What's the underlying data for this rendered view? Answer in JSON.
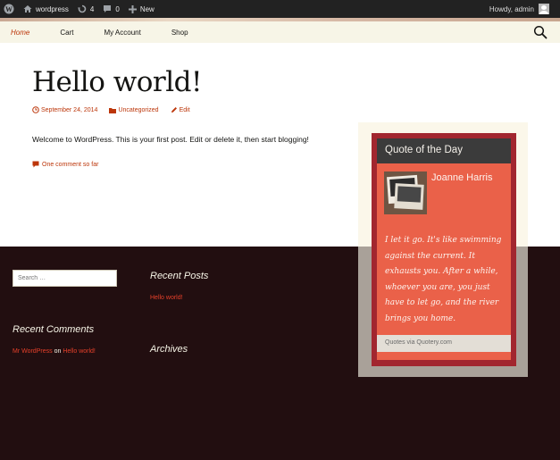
{
  "admin_bar": {
    "site_name": "wordpress",
    "updates_count": "4",
    "comments_count": "0",
    "new_label": "New",
    "greeting": "Howdy, admin"
  },
  "nav": {
    "items": [
      {
        "label": "Home"
      },
      {
        "label": "Cart"
      },
      {
        "label": "My Account"
      },
      {
        "label": "Shop"
      }
    ]
  },
  "post": {
    "title": "Hello world!",
    "date": "September 24, 2014",
    "category": "Uncategorized",
    "edit_label": "Edit",
    "content": "Welcome to WordPress. This is your first post. Edit or delete it, then start blogging!",
    "comments_link": "One comment so far"
  },
  "footer": {
    "search_placeholder": "Search …",
    "recent_comments_title": "Recent Comments",
    "comment_author": "Mr WordPress",
    "comment_on": "on",
    "comment_post": "Hello world!",
    "recent_posts_title": "Recent Posts",
    "recent_post": "Hello world!",
    "archives_title": "Archives"
  },
  "quote_widget": {
    "title": "Quote of the Day",
    "author": "Joanne Harris",
    "quote": "I let it go. It's like swimming against the current. It exhausts you. After a while, whoever you are, you just have to let go, and the river brings you home.",
    "footer": "Quotes via Quotery.com"
  },
  "colors": {
    "accent": "#bc360a",
    "footer_bg": "#220e10",
    "quote_bg": "#ea6149",
    "quote_border": "#a2262f"
  }
}
